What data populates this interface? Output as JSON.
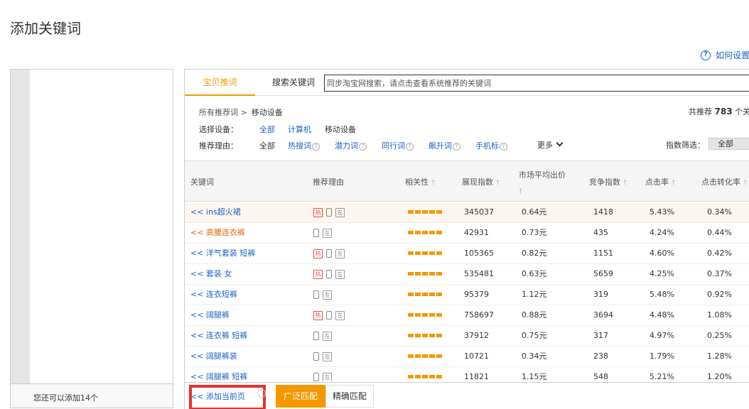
{
  "page_title": "添加关键词",
  "help_link": {
    "label": "如何设置"
  },
  "left_panel": {
    "footer_text": "您还可以添加14个"
  },
  "tabs": [
    {
      "label": "宝贝推词",
      "active": true
    },
    {
      "label": "搜索关键词",
      "active": false
    }
  ],
  "search": {
    "value": "同步淘宝网搜索，请点击查看系统推荐的关键词"
  },
  "breadcrumb": {
    "root": "所有推荐词 >",
    "current": "移动设备"
  },
  "total": {
    "prefix": "共推荐",
    "count": "783",
    "suffix": "个关"
  },
  "device_filter": {
    "label": "选择设备：",
    "options": [
      "全部",
      "计算机",
      "移动设备"
    ]
  },
  "reason_filter": {
    "label": "推荐理由：",
    "options": [
      "全部",
      "热搜词",
      "潜力词",
      "同行词",
      "飙升词",
      "手机标"
    ],
    "more": "更多"
  },
  "index_filter": {
    "label": "指数筛选：",
    "value": "全部"
  },
  "columns": {
    "keyword": "关键词",
    "reason": "推荐理由",
    "relevance": "相关性",
    "impressions": "展现指数",
    "avg_price_line1": "市场平均出价",
    "competition": "竞争指数",
    "ctr": "点击率",
    "cvr": "点击转化率"
  },
  "badges": {
    "hot": "热",
    "left": "左"
  },
  "rows": [
    {
      "keyword": "<< ins超火裙",
      "hot": true,
      "impressions": "345037",
      "price": "0.64元",
      "competition": "1418",
      "ctr": "5.43%",
      "cvr": "0.34%"
    },
    {
      "keyword": "<< 高腰连衣裤",
      "hot": false,
      "impressions": "42931",
      "price": "0.73元",
      "competition": "435",
      "ctr": "4.24%",
      "cvr": "0.44%"
    },
    {
      "keyword": "<< 洋气套装 短裤",
      "hot": true,
      "impressions": "105365",
      "price": "0.82元",
      "competition": "1151",
      "ctr": "4.60%",
      "cvr": "0.42%"
    },
    {
      "keyword": "<< 套装 女",
      "hot": true,
      "impressions": "535481",
      "price": "0.63元",
      "competition": "5659",
      "ctr": "4.25%",
      "cvr": "0.37%"
    },
    {
      "keyword": "<< 连衣短裤",
      "hot": false,
      "impressions": "95379",
      "price": "1.12元",
      "competition": "319",
      "ctr": "5.48%",
      "cvr": "0.92%"
    },
    {
      "keyword": "<< 阔腿裤",
      "hot": true,
      "impressions": "758697",
      "price": "0.88元",
      "competition": "3694",
      "ctr": "4.48%",
      "cvr": "1.08%"
    },
    {
      "keyword": "<< 连衣裤 短裤",
      "hot": false,
      "impressions": "37912",
      "price": "0.75元",
      "competition": "317",
      "ctr": "4.97%",
      "cvr": "0.25%"
    },
    {
      "keyword": "<< 阔腿裤装",
      "hot": false,
      "impressions": "10721",
      "price": "0.34元",
      "competition": "238",
      "ctr": "1.79%",
      "cvr": "1.28%"
    },
    {
      "keyword": "<< 阔腿裤 短裤",
      "hot": false,
      "impressions": "11821",
      "price": "1.15元",
      "competition": "548",
      "ctr": "5.21%",
      "cvr": "1.20%"
    }
  ],
  "bottom": {
    "add_current": "<< 添加当前页",
    "broad_match": "广泛匹配",
    "exact_match": "精确匹配"
  },
  "colors": {
    "accent": "#f39800",
    "link": "#1a62c4",
    "highlight": "#e8322e"
  }
}
